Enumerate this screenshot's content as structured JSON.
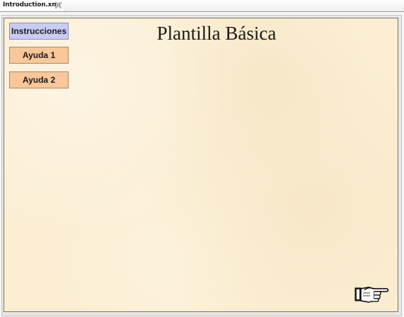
{
  "tab": {
    "label": "Introduction.xml",
    "close_icon": "close-x-icon"
  },
  "slide": {
    "title": "Plantilla Básica",
    "background_color": "#fbeed3",
    "buttons": [
      {
        "label": "Instrucciones",
        "color": "#c9ccf2"
      },
      {
        "label": "Ayuda 1",
        "color": "#f9c79a"
      },
      {
        "label": "Ayuda 2",
        "color": "#f9c79a"
      }
    ],
    "next_icon": "pointing-hand-right-icon"
  }
}
